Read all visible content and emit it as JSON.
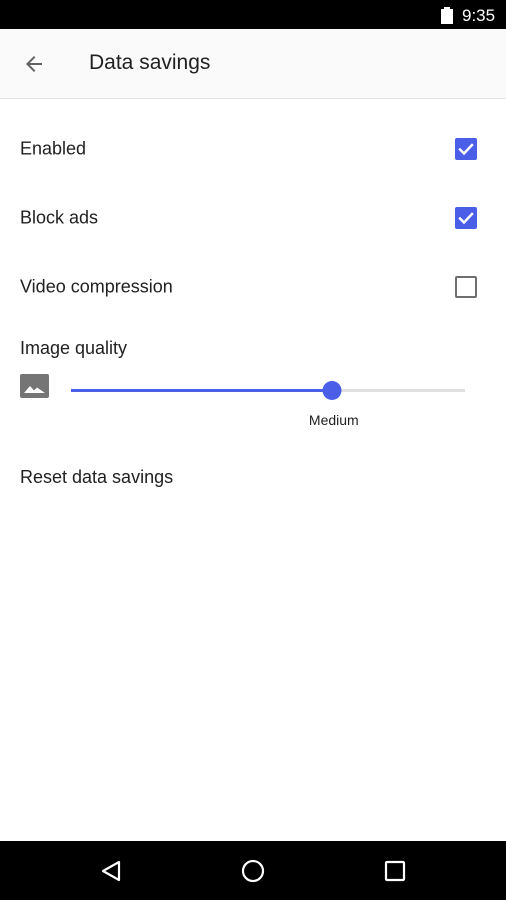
{
  "status_bar": {
    "time": "9:35",
    "battery_icon": "battery-full-icon"
  },
  "app_bar": {
    "title": "Data savings",
    "back_icon": "arrow-back-icon"
  },
  "settings": {
    "enabled": {
      "label": "Enabled",
      "checked": true
    },
    "block_ads": {
      "label": "Block ads",
      "checked": true
    },
    "video_compression": {
      "label": "Video compression",
      "checked": false
    }
  },
  "image_quality": {
    "label": "Image quality",
    "icon": "image-icon",
    "slider_fraction": 0.662,
    "value_label": "Medium"
  },
  "reset": {
    "label": "Reset data savings"
  },
  "nav_bar": {
    "back_icon": "nav-back-icon",
    "home_icon": "nav-home-icon",
    "recents_icon": "nav-recents-icon"
  },
  "colors": {
    "accent": "#4a5ee8",
    "text": "#212121",
    "bar_background": "#fafafa"
  }
}
